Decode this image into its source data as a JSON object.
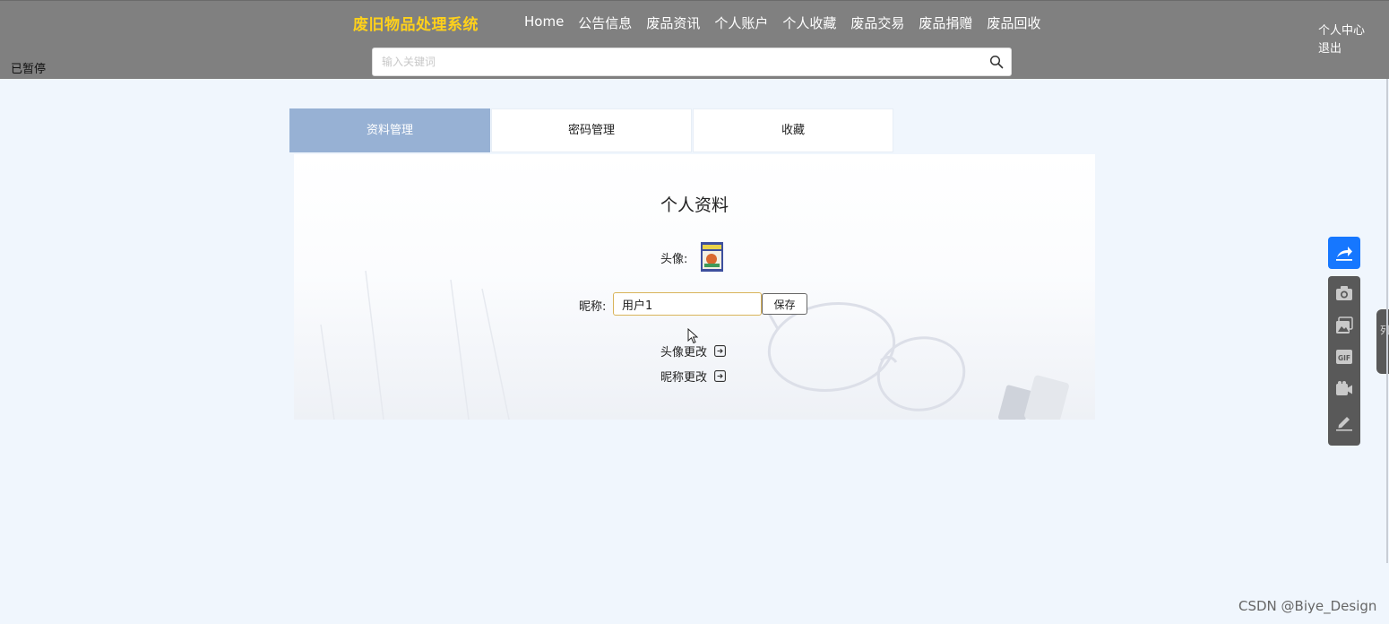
{
  "header": {
    "paused_label": "已暂停",
    "brand": "废旧物品处理系统",
    "nav": [
      "Home",
      "公告信息",
      "废品资讯",
      "个人账户",
      "个人收藏",
      "废品交易",
      "废品捐赠",
      "废品回收"
    ],
    "user_center": "个人中心",
    "logout": "退出",
    "search": {
      "placeholder": "输入关键词",
      "value": ""
    }
  },
  "tabs": [
    {
      "label": "资料管理",
      "active": true
    },
    {
      "label": "密码管理",
      "active": false
    },
    {
      "label": "收藏",
      "active": false
    }
  ],
  "profile": {
    "title": "个人资料",
    "avatar_label": "头像:",
    "nickname_label": "昵称:",
    "nickname_value": "用户1",
    "save_label": "保存",
    "change_avatar": "头像更改",
    "change_nickname": "昵称更改"
  },
  "toolbar": {
    "edge_label": "列",
    "items": [
      "share-icon",
      "camera-icon",
      "image-icon",
      "gif-icon",
      "video-icon",
      "pen-icon"
    ]
  },
  "watermark": "CSDN @Biye_Design",
  "colors": {
    "header_bg": "#808080",
    "brand": "#ffd11a",
    "active_tab": "#97b1d4",
    "page_bg": "#f0f6fd",
    "share_button": "#1677ff"
  }
}
